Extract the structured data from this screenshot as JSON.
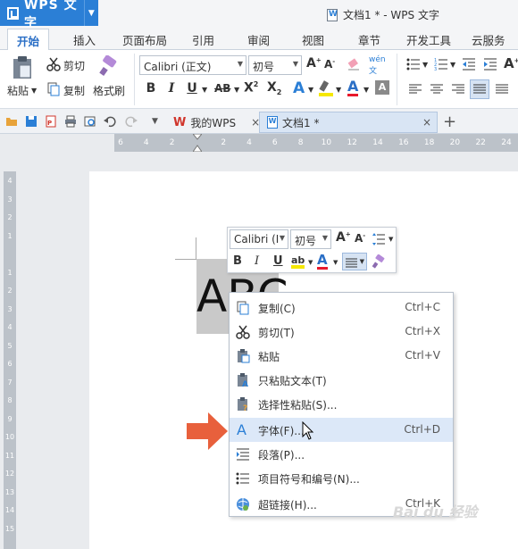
{
  "app": {
    "name": "WPS 文字",
    "window_title": "文档1 * - WPS 文字"
  },
  "tabs": [
    "开始",
    "插入",
    "页面布局",
    "引用",
    "审阅",
    "视图",
    "章节",
    "开发工具",
    "云服务"
  ],
  "ribbon": {
    "paste": "粘贴",
    "cut": "剪切",
    "copy": "复制",
    "format_painter": "格式刷",
    "font_name": "Calibri (正文)",
    "font_size": "初号"
  },
  "quick_bar": {
    "doc_tabs": [
      {
        "label": "我的WPS"
      },
      {
        "label": "文档1 *"
      }
    ]
  },
  "ruler": {
    "h_ticks": [
      "6",
      "4",
      "2",
      "",
      "2",
      "4",
      "6",
      "8",
      "10",
      "12",
      "14",
      "16",
      "18",
      "20",
      "22",
      "24",
      "26"
    ],
    "v_ticks": [
      "4",
      "3",
      "2",
      "1",
      "",
      "1",
      "2",
      "3",
      "4",
      "5",
      "6",
      "7",
      "8",
      "9",
      "10",
      "11",
      "12",
      "13",
      "14",
      "15"
    ]
  },
  "document": {
    "text": "ABC"
  },
  "mini_toolbar": {
    "font_name": "Calibri (I",
    "font_size": "初号"
  },
  "context_menu": {
    "items": [
      {
        "label": "复制(C)",
        "shortcut": "Ctrl+C",
        "icon": "copy-icon"
      },
      {
        "label": "剪切(T)",
        "shortcut": "Ctrl+X",
        "icon": "scissors-icon"
      },
      {
        "label": "粘贴",
        "shortcut": "Ctrl+V",
        "icon": "clipboard-icon"
      },
      {
        "label": "只粘贴文本(T)",
        "shortcut": "",
        "icon": "paste-text-icon"
      },
      {
        "label": "选择性粘贴(S)...",
        "shortcut": "",
        "icon": "paste-special-icon"
      },
      {
        "label": "字体(F)...",
        "shortcut": "Ctrl+D",
        "icon": "font-icon",
        "highlighted": true
      },
      {
        "label": "段落(P)...",
        "shortcut": "",
        "icon": "paragraph-icon"
      },
      {
        "label": "项目符号和编号(N)...",
        "shortcut": "",
        "icon": "bullets-icon"
      },
      {
        "label": "超链接(H)...",
        "shortcut": "Ctrl+K",
        "icon": "hyperlink-icon"
      }
    ]
  },
  "watermark": "Bai du 经验",
  "colors": {
    "accent": "#2b7fd6",
    "highlight": "#dce8f8",
    "arrow": "#e8603c"
  }
}
